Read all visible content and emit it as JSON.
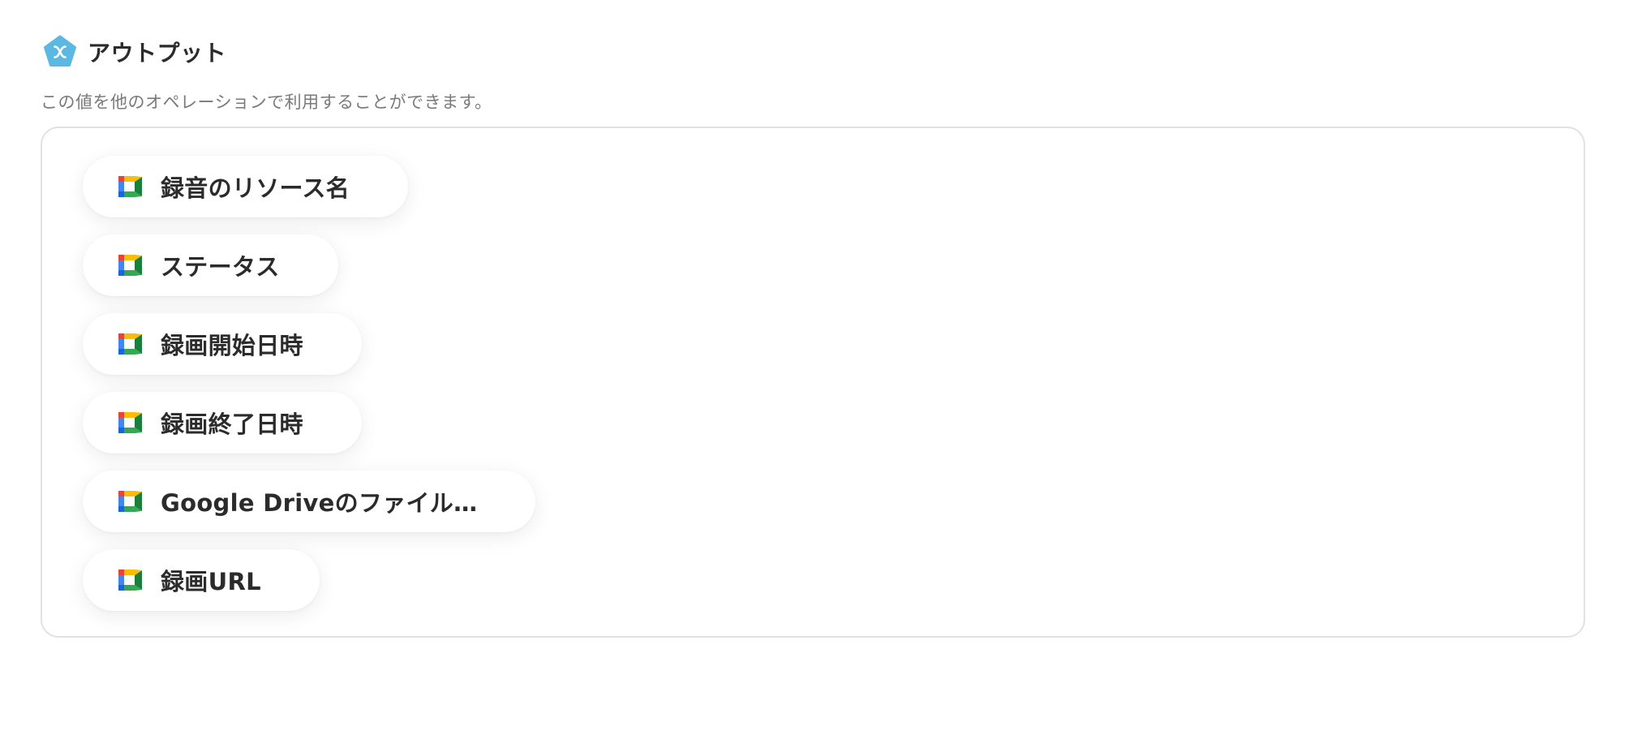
{
  "section": {
    "title": "アウトプット",
    "description": "この値を他のオペレーションで利用することができます。",
    "header_icon": "pentagon-x-icon",
    "header_icon_color": "#5bb8e3"
  },
  "outputs": [
    {
      "label": "録音のリソース名",
      "icon": "google-meet-icon"
    },
    {
      "label": "ステータス",
      "icon": "google-meet-icon"
    },
    {
      "label": "録画開始日時",
      "icon": "google-meet-icon"
    },
    {
      "label": "録画終了日時",
      "icon": "google-meet-icon"
    },
    {
      "label": "Google Driveのファイル…",
      "icon": "google-meet-icon"
    },
    {
      "label": "録画URL",
      "icon": "google-meet-icon"
    }
  ],
  "colors": {
    "border": "#e2e2e2",
    "description_text": "#7a7a7a",
    "meet_blue": "#4285f4",
    "meet_green": "#34a853",
    "meet_yellow": "#fbbc04",
    "meet_red": "#ea4335",
    "meet_dark_green": "#188038"
  }
}
